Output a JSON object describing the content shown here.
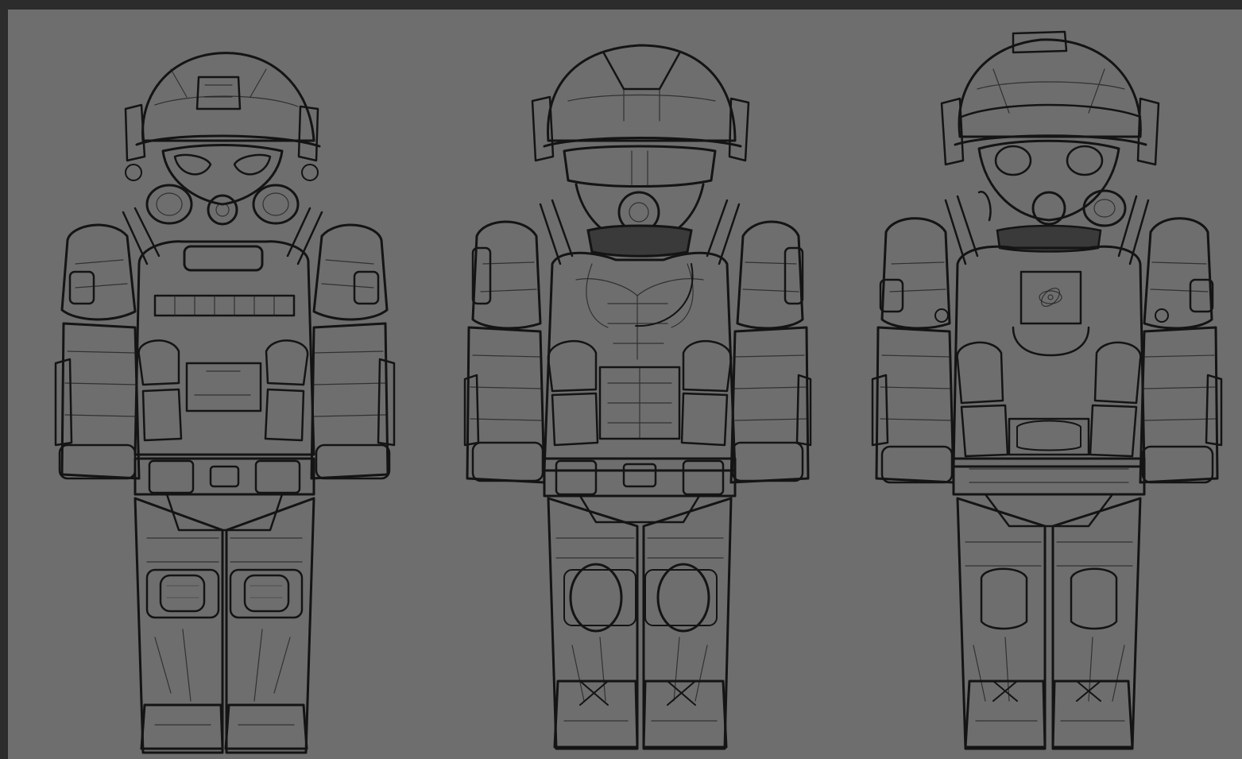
{
  "window": {
    "bg_color": "#2b2b2b",
    "canvas_color": "#6e6e6e",
    "ink_color": "#141414"
  },
  "canvas": {
    "content": "sketch-lineart",
    "figures": [
      {
        "name": "soldier-gasmask-helmet-1",
        "icon": "figure-sketch"
      },
      {
        "name": "soldier-goggles-helmet-2",
        "icon": "figure-sketch"
      },
      {
        "name": "soldier-gasmask-helmet-3",
        "icon": "figure-sketch"
      }
    ]
  }
}
